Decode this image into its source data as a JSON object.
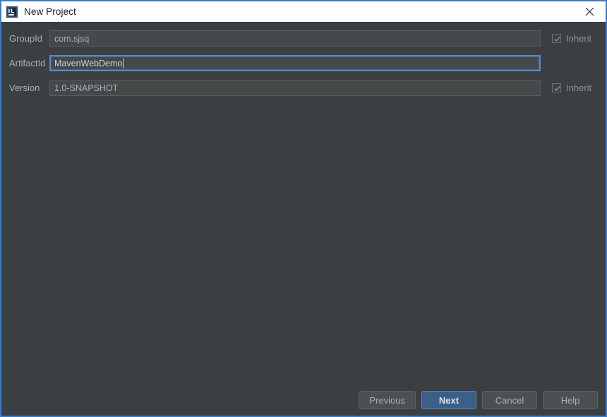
{
  "window": {
    "title": "New Project",
    "icon": "intellij-idea-icon",
    "close_icon": "close-icon",
    "border_color": "#3a7cc4",
    "titlebar_bg": "#ffffff",
    "body_bg": "#3c3f41"
  },
  "form": {
    "rows": [
      {
        "label": "GroupId",
        "value": "com.sjsq",
        "focused": false,
        "inherit": {
          "label": "Inherit",
          "checked": true,
          "enabled": false
        }
      },
      {
        "label": "ArtifactId",
        "value": "MavenWebDemo",
        "focused": true,
        "inherit": null
      },
      {
        "label": "Version",
        "value": "1.0-SNAPSHOT",
        "focused": false,
        "inherit": {
          "label": "Inherit",
          "checked": true,
          "enabled": false
        }
      }
    ]
  },
  "buttons": {
    "previous": "Previous",
    "next": "Next",
    "cancel": "Cancel",
    "help": "Help",
    "default_button": "Next",
    "default_color": "#3c5f8a"
  }
}
